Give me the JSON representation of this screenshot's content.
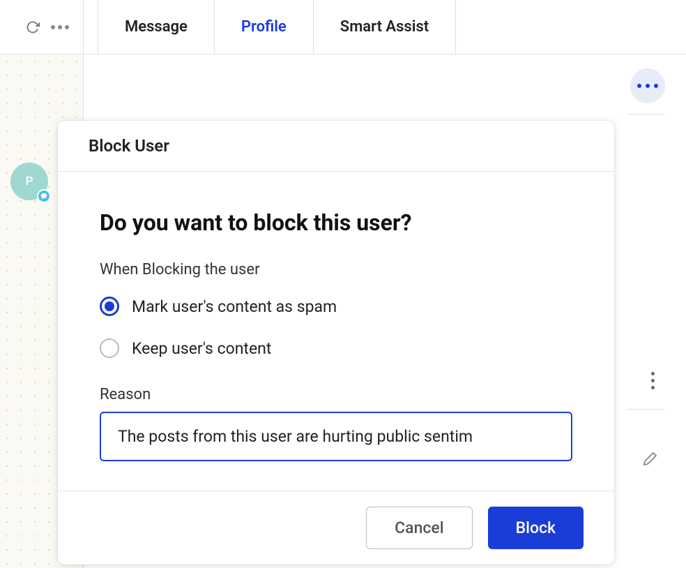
{
  "toolbar": {
    "more_label": "More"
  },
  "tabs": [
    {
      "label": "Message",
      "active": false
    },
    {
      "label": "Profile",
      "active": true
    },
    {
      "label": "Smart Assist",
      "active": false
    }
  ],
  "avatar": {
    "initial": "P"
  },
  "modal": {
    "title": "Block User",
    "heading": "Do you want to block this user?",
    "section_label": "When Blocking the user",
    "options": [
      {
        "label": "Mark user's content as spam",
        "selected": true
      },
      {
        "label": "Keep user's content",
        "selected": false
      }
    ],
    "reason_label": "Reason",
    "reason_value": "The posts from this user are hurting public sentim",
    "cancel_label": "Cancel",
    "confirm_label": "Block"
  }
}
